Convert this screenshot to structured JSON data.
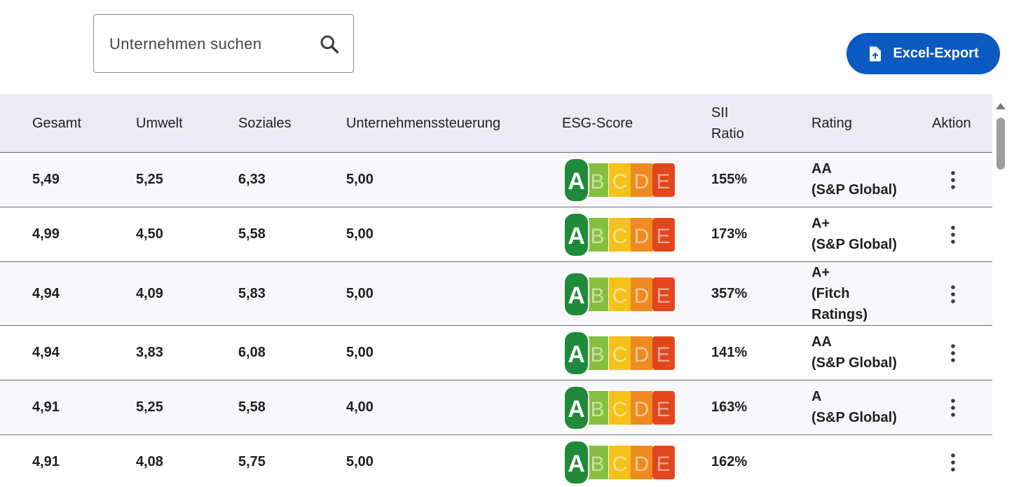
{
  "search": {
    "placeholder": "Unternehmen suchen"
  },
  "export": {
    "label": "Excel-Export"
  },
  "table": {
    "headers": {
      "gesamt": "Gesamt",
      "umwelt": "Umwelt",
      "soziales": "Soziales",
      "steuerung": "Unternehmenssteuerung",
      "esg": "ESG-Score",
      "sii_line1": "SII",
      "sii_line2": "Ratio",
      "rating": "Rating",
      "aktion": "Aktion"
    },
    "esg_letters": [
      "A",
      "B",
      "C",
      "D",
      "E"
    ],
    "rows": [
      {
        "gesamt": "5,49",
        "umwelt": "5,25",
        "soziales": "6,33",
        "steuerung": "5,00",
        "esg": "A",
        "sii": "155%",
        "rating_lines": [
          "AA",
          "(S&P Global)"
        ]
      },
      {
        "gesamt": "4,99",
        "umwelt": "4,50",
        "soziales": "5,58",
        "steuerung": "5,00",
        "esg": "A",
        "sii": "173%",
        "rating_lines": [
          "A+",
          "(S&P Global)"
        ]
      },
      {
        "gesamt": "4,94",
        "umwelt": "4,09",
        "soziales": "5,83",
        "steuerung": "5,00",
        "esg": "A",
        "sii": "357%",
        "rating_lines": [
          "A+",
          "(Fitch",
          "Ratings)"
        ]
      },
      {
        "gesamt": "4,94",
        "umwelt": "3,83",
        "soziales": "6,08",
        "steuerung": "5,00",
        "esg": "A",
        "sii": "141%",
        "rating_lines": [
          "AA",
          "(S&P Global)"
        ]
      },
      {
        "gesamt": "4,91",
        "umwelt": "5,25",
        "soziales": "5,58",
        "steuerung": "4,00",
        "esg": "A",
        "sii": "163%",
        "rating_lines": [
          "A",
          "(S&P Global)"
        ]
      },
      {
        "gesamt": "4,91",
        "umwelt": "4,08",
        "soziales": "5,75",
        "steuerung": "5,00",
        "esg": "A",
        "sii": "162%",
        "rating_lines": []
      }
    ]
  },
  "colors": {
    "accent": "#0a5ac2",
    "header_bg": "#ecebf5",
    "esg_a": "#1e8a3a",
    "esg_b": "#86bf3f",
    "esg_c": "#f4c21a",
    "esg_d": "#ee8a1f",
    "esg_e": "#e2461d"
  },
  "icons": {
    "search": "search-icon",
    "export": "file-upload-icon",
    "action": "more-vert-icon"
  }
}
